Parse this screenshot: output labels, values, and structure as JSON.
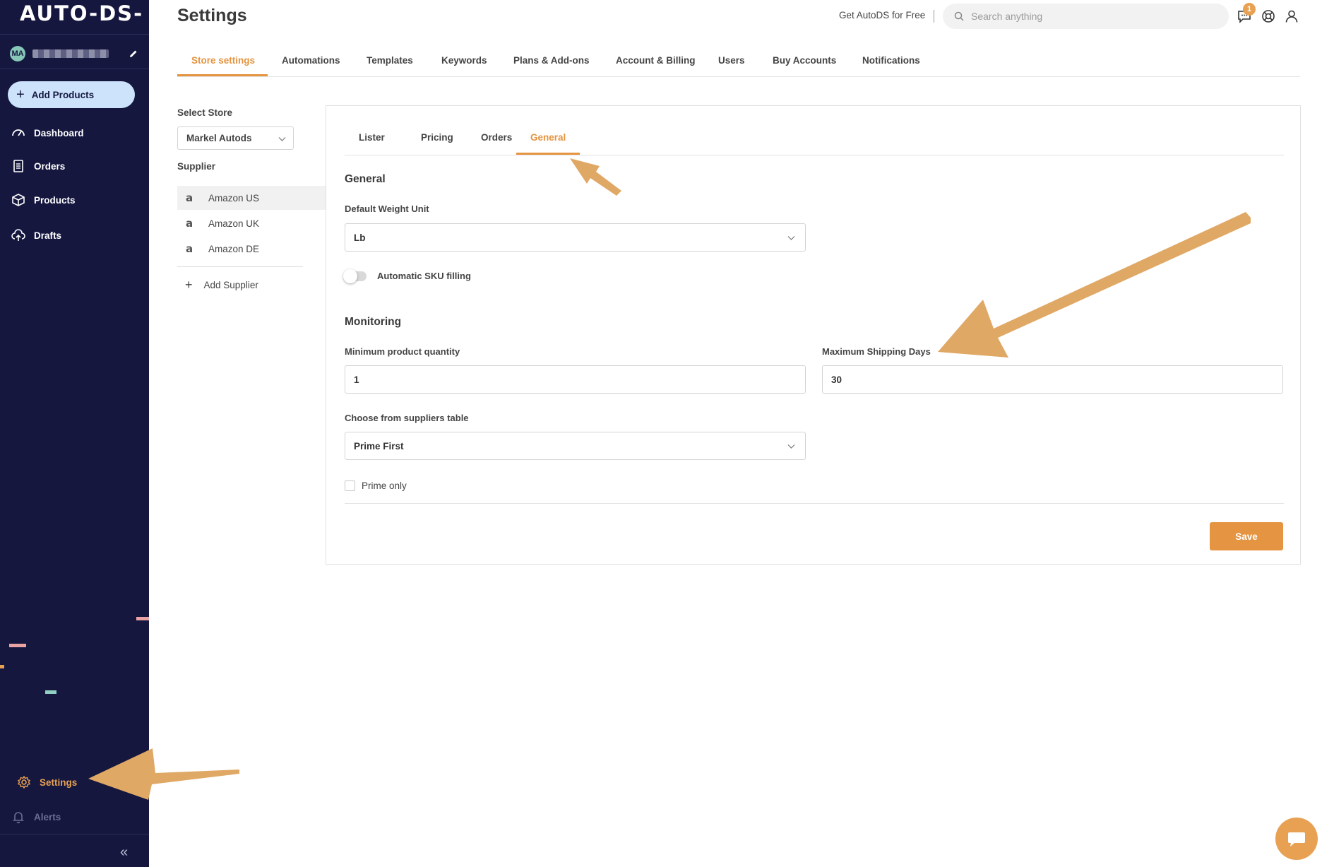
{
  "app": {
    "logo_text": "AUTO-DS-"
  },
  "user": {
    "initials": "MA"
  },
  "sidebar": {
    "add_products_label": "Add Products",
    "items": [
      {
        "label": "Dashboard",
        "icon": "dashboard-icon"
      },
      {
        "label": "Orders",
        "icon": "orders-icon"
      },
      {
        "label": "Products",
        "icon": "products-icon"
      },
      {
        "label": "Drafts",
        "icon": "cloud-upload-icon"
      }
    ],
    "settings_label": "Settings",
    "alerts_label": "Alerts",
    "collapse_icon": "double-chevron-left-icon"
  },
  "header": {
    "title": "Settings",
    "get_free_label": "Get AutoDS for Free",
    "search_placeholder": "Search anything",
    "notification_count": "1",
    "icons": [
      "chat-icon",
      "help-icon",
      "user-icon"
    ]
  },
  "top_tabs": [
    "Store settings",
    "Automations",
    "Templates",
    "Keywords",
    "Plans & Add-ons",
    "Account & Billing",
    "Users",
    "Buy Accounts",
    "Notifications"
  ],
  "top_tabs_active": "Store settings",
  "store": {
    "select_label": "Select Store",
    "selected": "Markel Autods",
    "supplier_label": "Supplier",
    "suppliers": [
      "Amazon US",
      "Amazon UK",
      "Amazon DE"
    ],
    "add_supplier_label": "Add Supplier"
  },
  "inner_tabs": [
    "Lister",
    "Pricing",
    "Orders",
    "General"
  ],
  "inner_tabs_active": "General",
  "general": {
    "title": "General",
    "weight_unit_label": "Default Weight Unit",
    "weight_unit_value": "Lb",
    "sku_filling_label": "Automatic SKU filling",
    "sku_filling_on": false
  },
  "monitoring": {
    "title": "Monitoring",
    "min_qty_label": "Minimum product quantity",
    "min_qty_value": "1",
    "max_shipping_label": "Maximum Shipping Days",
    "max_shipping_value": "30",
    "suppliers_table_label": "Choose from suppliers table",
    "suppliers_table_value": "Prime First",
    "prime_only_label": "Prime only",
    "prime_only_checked": false
  },
  "save_label": "Save",
  "colors": {
    "sidebar_bg": "#15173f",
    "accent": "#e59441",
    "arrow": "#e0a865",
    "add_btn_bg": "#cde3fb"
  }
}
